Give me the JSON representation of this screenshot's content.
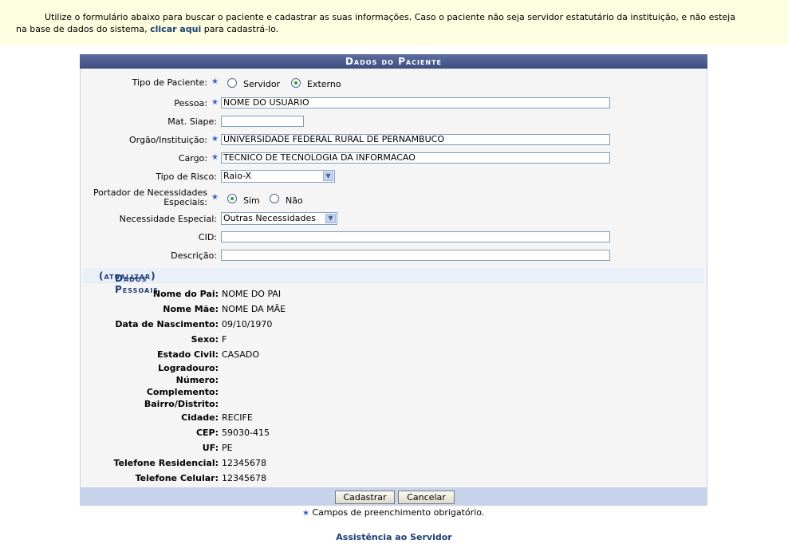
{
  "intro": {
    "text1": "Utilize o formulário abaixo para buscar o paciente e cadastrar as suas informações. Caso o paciente não seja servidor estatutário da instituição, e não esteja",
    "text2": "na base de dados do sistema,",
    "link": "clicar aqui",
    "text3": "para cadastrá-lo."
  },
  "panel": {
    "title": "Dados do Paciente",
    "tipo_paciente": {
      "label": "Tipo de Paciente:",
      "options": [
        "Servidor",
        "Externo"
      ],
      "selected": "Externo"
    },
    "pessoa": {
      "label": "Pessoa:",
      "value": "NOME DO USUÁRIO"
    },
    "mat_siape": {
      "label": "Mat. Siape:",
      "value": ""
    },
    "orgao": {
      "label": "Orgão/Instituição:",
      "value": "UNIVERSIDADE FEDERAL RURAL DE PERNAMBUCO"
    },
    "cargo": {
      "label": "Cargo:",
      "value": "TECNICO DE TECNOLOGIA DA INFORMACAO"
    },
    "tipo_risco": {
      "label": "Tipo de Risco:",
      "value": "Raio-X"
    },
    "portador": {
      "label_line1": "Portador de Necessidades",
      "label_line2": "Especiais:",
      "options": [
        "Sim",
        "Não"
      ],
      "selected": "Sim"
    },
    "necessidade": {
      "label": "Necessidade Especial:",
      "value": "Outras Necessidades"
    },
    "cid": {
      "label": "CID:",
      "value": ""
    },
    "descricao": {
      "label": "Descrição:",
      "value": ""
    }
  },
  "dados_pessoais": {
    "title": "Dados Pessoais",
    "link": "(atualizar)",
    "fields": [
      {
        "label": "Nome do Pai:",
        "value": "NOME DO PAI"
      },
      {
        "label": "Nome Mãe:",
        "value": "NOME DA MÃE"
      },
      {
        "label": "Data de Nascimento:",
        "value": "09/10/1970"
      },
      {
        "label": "Sexo:",
        "value": "F"
      },
      {
        "label": "Estado Civil:",
        "value": "CASADO"
      },
      {
        "label": "Logradouro:",
        "value": ""
      },
      {
        "label": "Número:",
        "value": ""
      },
      {
        "label": "Complemento:",
        "value": ""
      },
      {
        "label": "Bairro/Distrito:",
        "value": ""
      },
      {
        "label": "Cidade:",
        "value": "RECIFE"
      },
      {
        "label": "CEP:",
        "value": "59030-415"
      },
      {
        "label": "UF:",
        "value": "PE"
      },
      {
        "label": "Telefone Residencial:",
        "value": "12345678"
      },
      {
        "label": "Telefone Celular:",
        "value": "12345678"
      }
    ]
  },
  "buttons": {
    "cadastrar": "Cadastrar",
    "cancelar": "Cancelar"
  },
  "required_note": "Campos de preenchimento obrigatório.",
  "back_link": "Assistência ao Servidor",
  "colors": {
    "caption": "#4a5a8c",
    "link": "#1d3d75",
    "required_star": "#3a63c4",
    "intro_bg": "#fdfde0"
  }
}
